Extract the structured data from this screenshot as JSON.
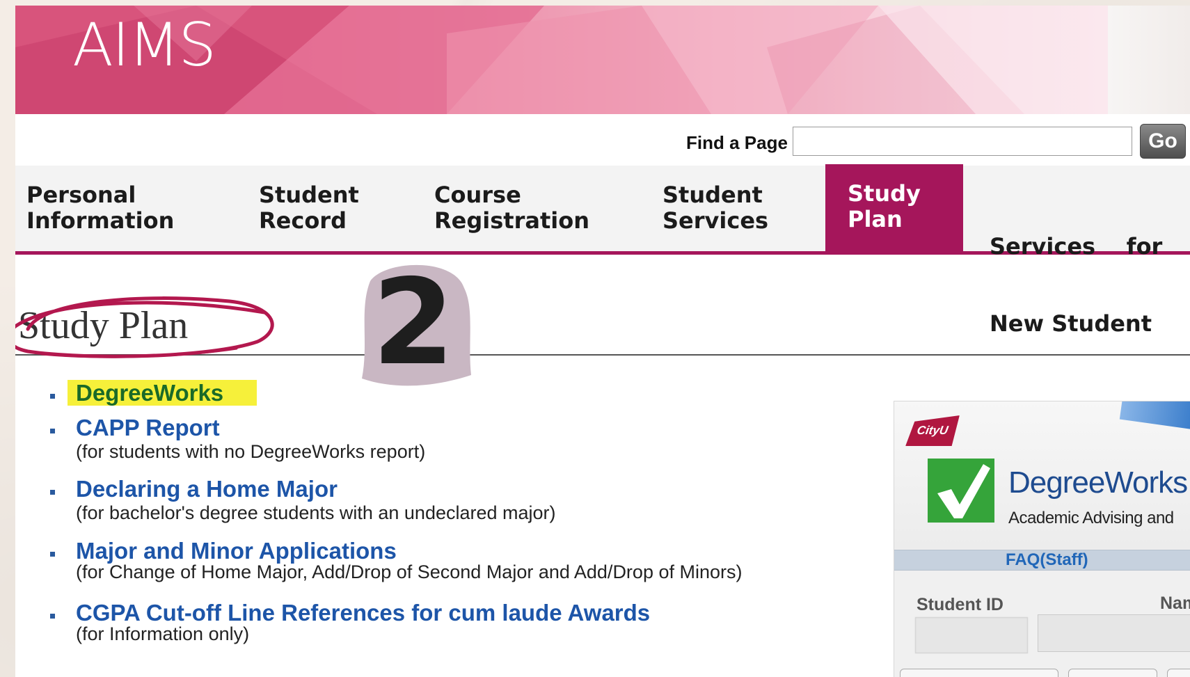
{
  "banner": {
    "logo": "AIMS"
  },
  "find": {
    "label": "Find a Page",
    "value": "",
    "go_label": "Go"
  },
  "nav": {
    "items": [
      {
        "line1": "Personal",
        "line2": "Information"
      },
      {
        "line1": "Student",
        "line2": "Record"
      },
      {
        "line1": "Course",
        "line2": "Registration"
      },
      {
        "line1": "Student",
        "line2": "Services"
      },
      {
        "line1": "Study",
        "line2": "Plan"
      },
      {
        "line1": "Services    for",
        "line2": "New Student"
      }
    ],
    "active_index": 4
  },
  "page": {
    "title": "Study Plan",
    "step_badge": "2"
  },
  "links": [
    {
      "label": "DegreeWorks",
      "sub": ""
    },
    {
      "label": "CAPP Report",
      "sub": "(for students with no DegreeWorks report)"
    },
    {
      "label": "Declaring a Home Major",
      "sub": "(for bachelor's degree students with an undeclared major)"
    },
    {
      "label": "Major and Minor Applications",
      "sub": "(for Change of Home Major, Add/Drop of Second Major and Add/Drop of Minors)"
    },
    {
      "label": "CGPA Cut-off Line References for cum laude Awards",
      "sub": "(for Information only)"
    }
  ],
  "degreeworks_preview": {
    "org_logo": "CityU",
    "title": "DegreeWorks",
    "subtitle": "Academic Advising and",
    "faq": "FAQ(Staff)",
    "student_id_label": "Student ID",
    "name_label": "Nam"
  },
  "colors": {
    "brand": "#a5165b",
    "link": "#1d55a8",
    "highlight": "#f6f03a",
    "check_green": "#35a43a"
  }
}
